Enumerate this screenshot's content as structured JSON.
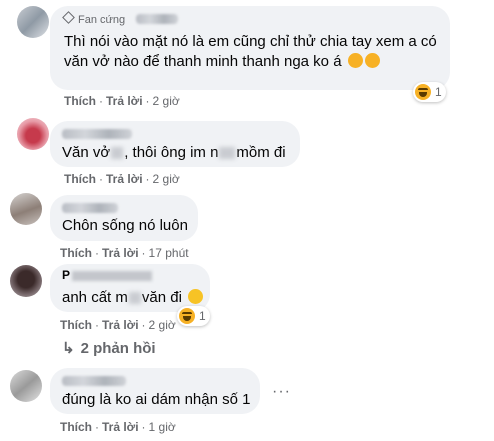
{
  "comments": [
    {
      "badge": "Fan cứng",
      "text_line1": "Thì nói vào mặt nó là em cũng chỉ thử chia tay xem a có",
      "text_line2": "văn vở nào để thanh minh thanh nga ko á",
      "like": "Thích",
      "reply": "Trả lời",
      "time": "2 giờ",
      "reaction_count": "1"
    },
    {
      "text_a": "Văn vở",
      "text_b": ", thôi ông im n",
      "text_c": "mồm đi",
      "like": "Thích",
      "reply": "Trả lời",
      "time": "2 giờ"
    },
    {
      "text": "Chôn sống nó luôn",
      "like": "Thích",
      "reply": "Trả lời",
      "time": "17 phút"
    },
    {
      "name_partial": "P",
      "text_a": "anh cất m",
      "text_b": "văn đi",
      "like": "Thích",
      "reply": "Trả lời",
      "time": "2 giờ",
      "reaction_count": "1",
      "replies_label": "2 phản hồi"
    },
    {
      "text": "đúng là ko ai dám nhận số 1",
      "more": "···",
      "like": "Thích",
      "reply": "Trả lời",
      "time": "1 giờ"
    }
  ]
}
